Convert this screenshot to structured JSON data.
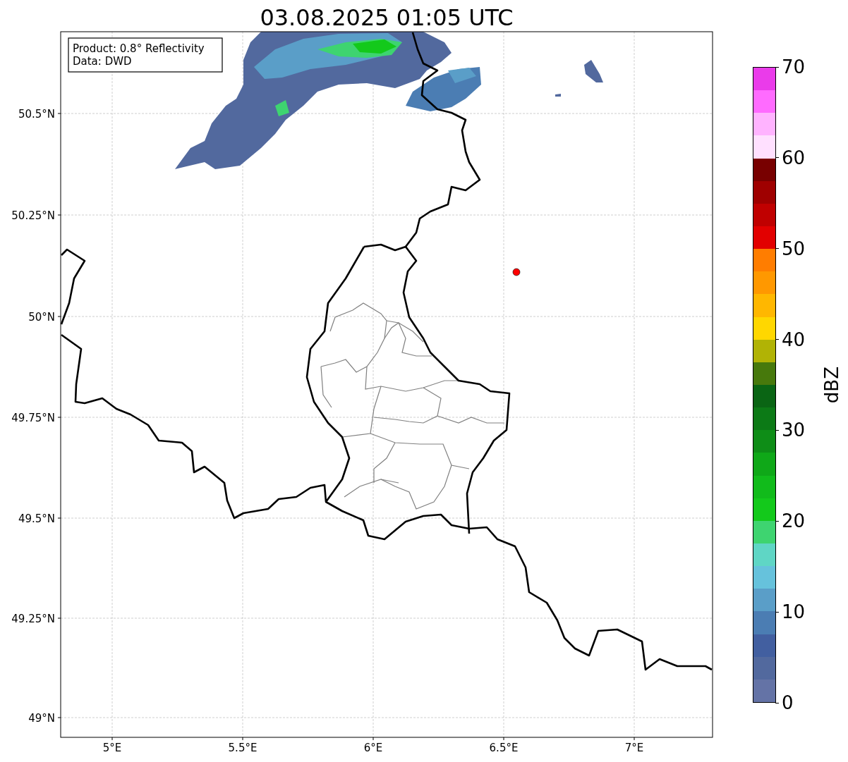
{
  "title": "03.08.2025 01:05 UTC",
  "info_box": [
    "Product: 0.8° Reflectivity",
    "Data: DWD"
  ],
  "x_ticks": [
    "5°E",
    "5.5°E",
    "6°E",
    "6.5°E",
    "7°E"
  ],
  "y_ticks": [
    "50.5°N",
    "50.25°N",
    "50°N",
    "49.75°N",
    "49.5°N",
    "49.25°N",
    "49°N"
  ],
  "colorbar": {
    "label": "dBZ",
    "ticks": [
      "70",
      "60",
      "50",
      "40",
      "30",
      "20",
      "10",
      "0"
    ],
    "segments": [
      {
        "color": "#ea3bea"
      },
      {
        "color": "#ff6bff"
      },
      {
        "color": "#ffb3ff"
      },
      {
        "color": "#ffe0ff"
      },
      {
        "color": "#780000"
      },
      {
        "color": "#9f0000"
      },
      {
        "color": "#c00000"
      },
      {
        "color": "#e20000"
      },
      {
        "color": "#ff7d00"
      },
      {
        "color": "#ff9800"
      },
      {
        "color": "#ffb700"
      },
      {
        "color": "#ffd700"
      },
      {
        "color": "#b1b305"
      },
      {
        "color": "#47790c"
      },
      {
        "color": "#0a6514"
      },
      {
        "color": "#0c7a16"
      },
      {
        "color": "#0e8d17"
      },
      {
        "color": "#0fa818"
      },
      {
        "color": "#11bb1b"
      },
      {
        "color": "#13c91b"
      },
      {
        "color": "#3ed470"
      },
      {
        "color": "#5fd6c5"
      },
      {
        "color": "#66c2dc"
      },
      {
        "color": "#5a9ec8"
      },
      {
        "color": "#4b7db3"
      },
      {
        "color": "#425fa0"
      },
      {
        "color": "#52699e"
      },
      {
        "color": "#6473a6"
      }
    ]
  }
}
